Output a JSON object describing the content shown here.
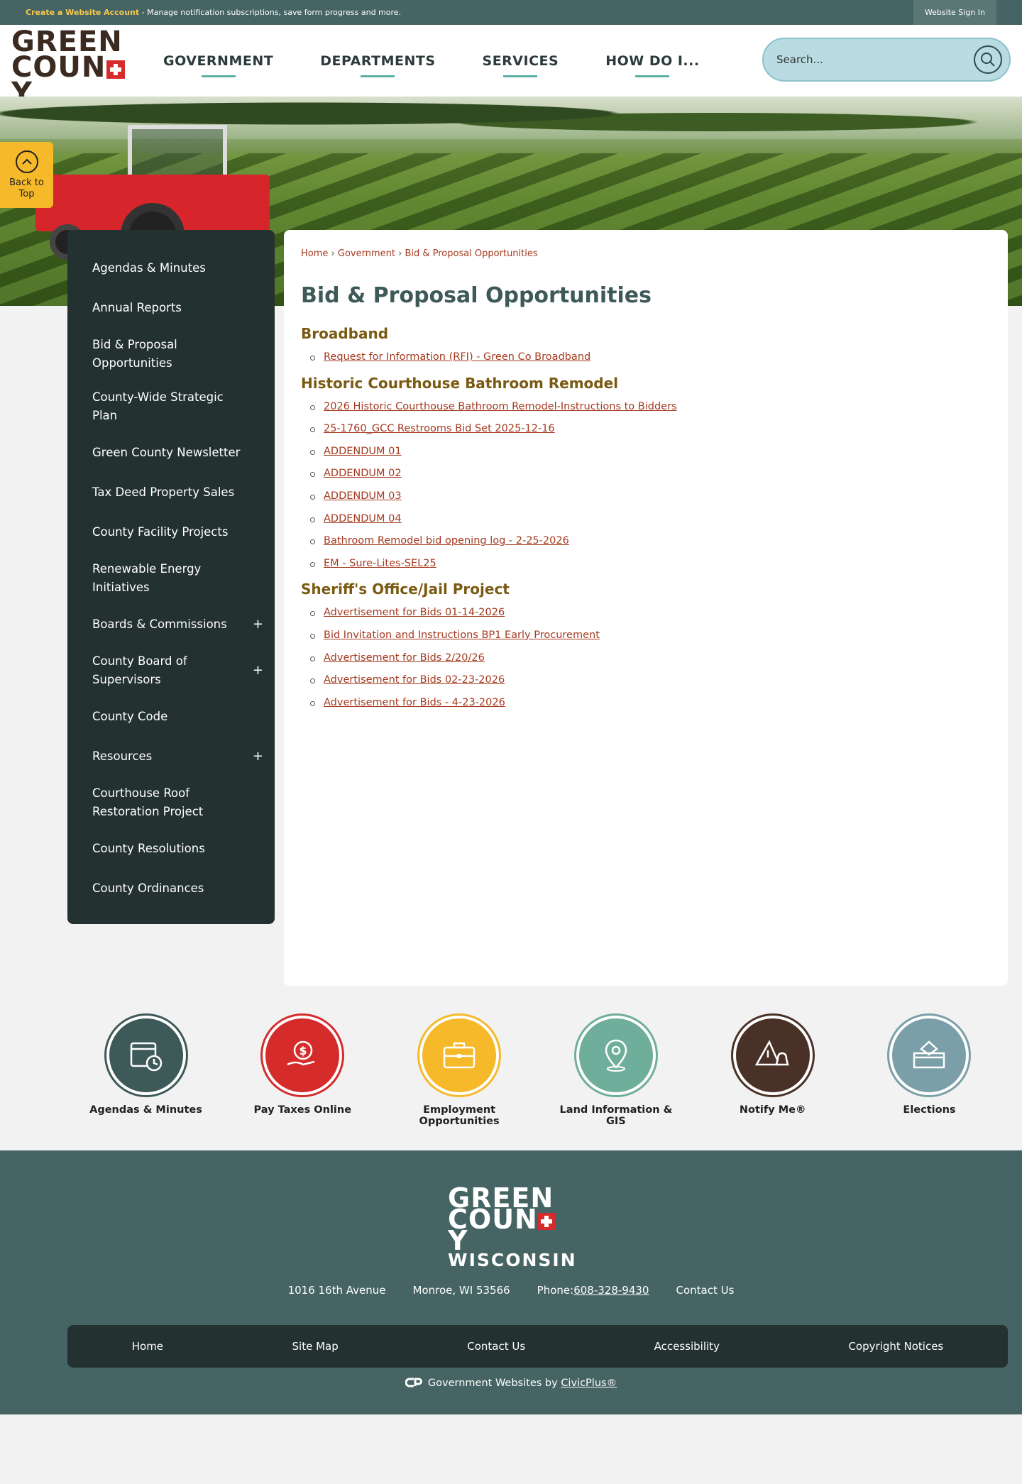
{
  "topbar": {
    "create_account": "Create a Website Account",
    "message": " - Manage notification subscriptions, save form progress and more.",
    "signin": "Website Sign In"
  },
  "logo": {
    "line1": "GREEN",
    "line2a": "COUN",
    "line2b": "Y",
    "line3": "WISCONSIN"
  },
  "nav": [
    "GOVERNMENT",
    "DEPARTMENTS",
    "SERVICES",
    "HOW DO I..."
  ],
  "search": {
    "placeholder": "Search..."
  },
  "back_to_top": {
    "line1": "Back to",
    "line2": "Top"
  },
  "sidebar": {
    "items": [
      {
        "label": "Agendas & Minutes",
        "expandable": false
      },
      {
        "label": "Annual Reports",
        "expandable": false
      },
      {
        "label": "Bid & Proposal Opportunities",
        "expandable": false
      },
      {
        "label": "County-Wide Strategic Plan",
        "expandable": false
      },
      {
        "label": "Green County Newsletter",
        "expandable": false
      },
      {
        "label": "Tax Deed Property Sales",
        "expandable": false
      },
      {
        "label": "County Facility Projects",
        "expandable": false
      },
      {
        "label": "Renewable Energy Initiatives",
        "expandable": false
      },
      {
        "label": "Boards & Commissions",
        "expandable": true
      },
      {
        "label": "County Board of Supervisors",
        "expandable": true
      },
      {
        "label": "County Code",
        "expandable": false
      },
      {
        "label": "Resources",
        "expandable": true
      },
      {
        "label": "Courthouse Roof Restoration Project",
        "expandable": false
      },
      {
        "label": "County Resolutions",
        "expandable": false
      },
      {
        "label": "County Ordinances",
        "expandable": false
      }
    ],
    "plus_symbol": "+"
  },
  "breadcrumb": {
    "home": "Home",
    "parent": "Government",
    "current": "Bid & Proposal Opportunities",
    "sep": "›"
  },
  "page_title": "Bid & Proposal Opportunities",
  "sections": [
    {
      "heading": "Broadband",
      "links": [
        "Request for Information (RFI) - Green Co Broadband"
      ]
    },
    {
      "heading": "Historic Courthouse Bathroom Remodel",
      "links": [
        "2026 Historic Courthouse Bathroom Remodel-Instructions to Bidders",
        "25-1760_GCC Restrooms Bid Set 2025-12-16",
        "ADDENDUM 01",
        "ADDENDUM 02",
        "ADDENDUM 03",
        "ADDENDUM 04",
        "Bathroom Remodel bid opening log - 2-25-2026",
        "EM - Sure-Lites-SEL25"
      ]
    },
    {
      "heading": "Sheriff's Office/Jail Project",
      "links": [
        "Advertisement for Bids 01-14-2026",
        "Bid Invitation and Instructions BP1 Early Procurement",
        "Advertisement for Bids 2/20/26",
        "Advertisement for Bids 02-23-2026",
        "Advertisement for Bids - 4-23-2026"
      ]
    }
  ],
  "quick_links": [
    {
      "label": "Agendas & Minutes",
      "icon": "calendar-clock-icon",
      "color": "#3e5a58"
    },
    {
      "label": "Pay Taxes Online",
      "icon": "hand-dollar-icon",
      "color": "#d52b2b"
    },
    {
      "label": "Employment Opportunities",
      "icon": "briefcase-icon",
      "color": "#f6b92a"
    },
    {
      "label": "Land Information & GIS",
      "icon": "map-pin-icon",
      "color": "#6fae9a"
    },
    {
      "label": "Notify Me®",
      "icon": "alert-bell-icon",
      "color": "#4a3127"
    },
    {
      "label": "Elections",
      "icon": "ballot-box-icon",
      "color": "#7b9fa8"
    }
  ],
  "footer": {
    "address": "1016 16th Avenue",
    "city": "Monroe, WI 53566",
    "phone_label": "Phone:",
    "phone": "608-328-9430",
    "contact": "Contact Us",
    "links": [
      "Home",
      "Site Map",
      "Contact Us",
      "Accessibility",
      "Copyright Notices"
    ],
    "civic_prefix": "Government Websites by ",
    "civic_link": "CivicPlus®"
  },
  "colors": {
    "teal": "#456463",
    "dark": "#233131",
    "link": "#a53a1f",
    "heading": "#7a5a12",
    "accent": "#5bb0a3",
    "yellow": "#f6b92a"
  }
}
